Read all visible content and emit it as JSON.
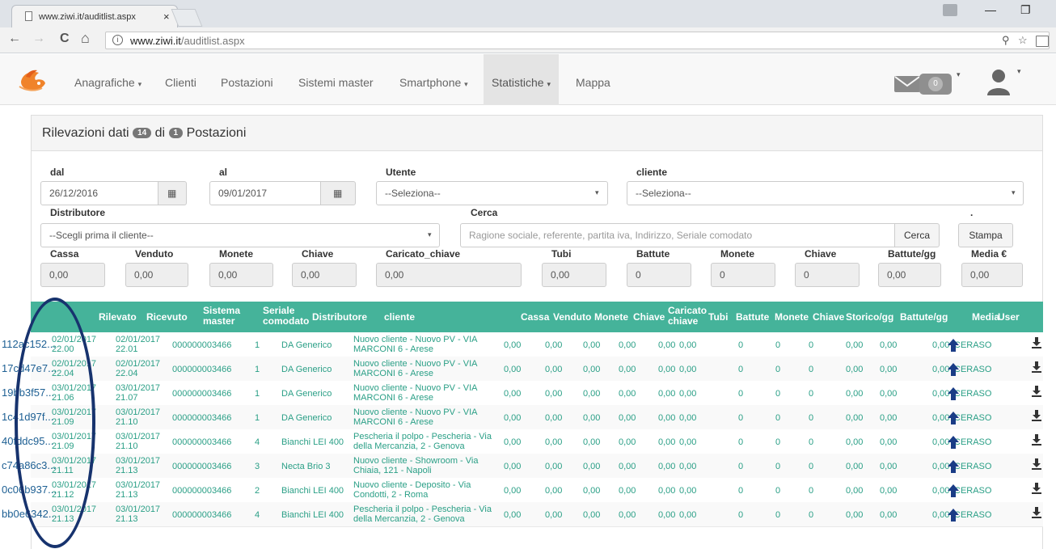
{
  "browser": {
    "tab_title": "www.ziwi.it/auditlist.aspx",
    "tab_close": "×",
    "url_host": "www.ziwi.it",
    "url_path": "/auditlist.aspx",
    "nav_back": "←",
    "nav_forward": "→",
    "nav_reload": "C",
    "nav_home": "⌂",
    "win_min": "—",
    "win_max": "❐",
    "zoom_icon": "⚲",
    "star_icon": "☆"
  },
  "appnav": {
    "items": [
      "Anagrafiche",
      "Clienti",
      "Postazioni",
      "Sistemi master",
      "Smartphone",
      "Statistiche",
      "Mappa"
    ],
    "active": "Statistiche",
    "dropdown_caret": "▾",
    "mail_count": "0",
    "colors": {
      "navbar_bg": "#f8f8f8",
      "accent": "#45b39a",
      "logo_orange": "#f0832a"
    }
  },
  "panel": {
    "title_prefix": "Rilevazioni dati",
    "count_rilevazioni": "14",
    "title_mid": "di",
    "count_postazioni": "1",
    "title_suffix": "Postazioni"
  },
  "filters": {
    "dal_label": "dal",
    "dal_value": "26/12/2016",
    "al_label": "al",
    "al_value": "09/01/2017",
    "utente_label": "Utente",
    "utente_value": "--Seleziona--",
    "cliente_label": "cliente",
    "cliente_value": "--Seleziona--",
    "distributore_label": "Distributore",
    "distributore_value": "--Scegli prima il cliente--",
    "cerca_label": "Cerca",
    "cerca_placeholder": "Ragione sociale, referente, partita iva, Indirizzo, Seriale comodato",
    "cerca_button": "Cerca",
    "stampa_label": ".",
    "stampa_button": "Stampa",
    "calendar_icon": "▦",
    "select_arrow": "▾"
  },
  "totals": {
    "labels": [
      "Cassa",
      "Venduto",
      "Monete",
      "Chiave",
      "Caricato_chiave",
      "Tubi",
      "Battute",
      "Monete",
      "Chiave",
      "Battute/gg",
      "Media €"
    ],
    "values": [
      "0,00",
      "0,00",
      "0,00",
      "0,00",
      "0,00",
      "0,00",
      "0",
      "0",
      "0",
      "0,00",
      "0,00"
    ]
  },
  "table": {
    "headers": [
      "Rilevato",
      "Ricevuto",
      "Sistema master",
      "Seriale comodato",
      "Distributore",
      "cliente",
      "Cassa",
      "Venduto",
      "Monete",
      "Chiave",
      "Caricato chiave",
      "Tubi",
      "Battute",
      "Monete",
      "Chiave",
      "Storico/gg",
      "Battute/gg",
      "Media",
      "User"
    ],
    "header_split": {
      "sistema_1": "Sistema",
      "sistema_2": "master",
      "seriale_1": "Seriale",
      "seriale_2": "comodato",
      "caricato_1": "Caricato",
      "caricato_2": "chiave"
    },
    "rows": [
      {
        "id": "112ac152...",
        "ril_d": "02/01/2017",
        "ril_t": "22.00",
        "ric_d": "02/01/2017",
        "ric_t": "22.01",
        "sistema": "000000003466",
        "seriale": "1",
        "distributore": "DA Generico",
        "cli_1": "Nuovo cliente - Nuovo PV - VIA",
        "cli_2": "MARCONI 6 - Arese",
        "cassa": "0,00",
        "venduto": "0,00",
        "monete": "0,00",
        "chiave": "0,00",
        "caricato": "0,00",
        "tubi": "0,00",
        "battute": "0",
        "monete2": "0",
        "chiave2": "0",
        "storico": "0,00",
        "battgg": "0,00",
        "media": "0,00",
        "user": "CERASO"
      },
      {
        "id": "17cd47e7...",
        "ril_d": "02/01/2017",
        "ril_t": "22.04",
        "ric_d": "02/01/2017",
        "ric_t": "22.04",
        "sistema": "000000003466",
        "seriale": "1",
        "distributore": "DA Generico",
        "cli_1": "Nuovo cliente - Nuovo PV - VIA",
        "cli_2": "MARCONI 6 - Arese",
        "cassa": "0,00",
        "venduto": "0,00",
        "monete": "0,00",
        "chiave": "0,00",
        "caricato": "0,00",
        "tubi": "0,00",
        "battute": "0",
        "monete2": "0",
        "chiave2": "0",
        "storico": "0,00",
        "battgg": "0,00",
        "media": "0,00",
        "user": "CERASO"
      },
      {
        "id": "19bb3f57...",
        "ril_d": "03/01/2017",
        "ril_t": "21.06",
        "ric_d": "03/01/2017",
        "ric_t": "21.07",
        "sistema": "000000003466",
        "seriale": "1",
        "distributore": "DA Generico",
        "cli_1": "Nuovo cliente - Nuovo PV - VIA",
        "cli_2": "MARCONI 6 - Arese",
        "cassa": "0,00",
        "venduto": "0,00",
        "monete": "0,00",
        "chiave": "0,00",
        "caricato": "0,00",
        "tubi": "0,00",
        "battute": "0",
        "monete2": "0",
        "chiave2": "0",
        "storico": "0,00",
        "battgg": "0,00",
        "media": "0,00",
        "user": "CERASO"
      },
      {
        "id": "1c41d97f...",
        "ril_d": "03/01/2017",
        "ril_t": "21.09",
        "ric_d": "03/01/2017",
        "ric_t": "21.10",
        "sistema": "000000003466",
        "seriale": "1",
        "distributore": "DA Generico",
        "cli_1": "Nuovo cliente - Nuovo PV - VIA",
        "cli_2": "MARCONI 6 - Arese",
        "cassa": "0,00",
        "venduto": "0,00",
        "monete": "0,00",
        "chiave": "0,00",
        "caricato": "0,00",
        "tubi": "0,00",
        "battute": "0",
        "monete2": "0",
        "chiave2": "0",
        "storico": "0,00",
        "battgg": "0,00",
        "media": "0,00",
        "user": "CERASO"
      },
      {
        "id": "40fddc95...",
        "ril_d": "03/01/2017",
        "ril_t": "21.09",
        "ric_d": "03/01/2017",
        "ric_t": "21.10",
        "sistema": "000000003466",
        "seriale": "4",
        "distributore": "Bianchi LEI 400",
        "cli_1": "Pescheria il polpo - Pescheria - Via",
        "cli_2": "della Mercanzia, 2 - Genova",
        "cassa": "0,00",
        "venduto": "0,00",
        "monete": "0,00",
        "chiave": "0,00",
        "caricato": "0,00",
        "tubi": "0,00",
        "battute": "0",
        "monete2": "0",
        "chiave2": "0",
        "storico": "0,00",
        "battgg": "0,00",
        "media": "0,00",
        "user": "CERASO"
      },
      {
        "id": "c74a86c3...",
        "ril_d": "03/01/2017",
        "ril_t": "21.11",
        "ric_d": "03/01/2017",
        "ric_t": "21.13",
        "sistema": "000000003466",
        "seriale": "3",
        "distributore": "Necta Brio 3",
        "cli_1": "Nuovo cliente - Showroom - Via",
        "cli_2": "Chiaia, 121 - Napoli",
        "cassa": "0,00",
        "venduto": "0,00",
        "monete": "0,00",
        "chiave": "0,00",
        "caricato": "0,00",
        "tubi": "0,00",
        "battute": "0",
        "monete2": "0",
        "chiave2": "0",
        "storico": "0,00",
        "battgg": "0,00",
        "media": "0,00",
        "user": "CERASO"
      },
      {
        "id": "0c06b937...",
        "ril_d": "03/01/2017",
        "ril_t": "21.12",
        "ric_d": "03/01/2017",
        "ric_t": "21.13",
        "sistema": "000000003466",
        "seriale": "2",
        "distributore": "Bianchi LEI 400",
        "cli_1": "Nuovo cliente - Deposito - Via",
        "cli_2": "Condotti, 2 - Roma",
        "cassa": "0,00",
        "venduto": "0,00",
        "monete": "0,00",
        "chiave": "0,00",
        "caricato": "0,00",
        "tubi": "0,00",
        "battute": "0",
        "monete2": "0",
        "chiave2": "0",
        "storico": "0,00",
        "battgg": "0,00",
        "media": "0,00",
        "user": "CERASO"
      },
      {
        "id": "bb0e6342...",
        "ril_d": "03/01/2017",
        "ril_t": "21.13",
        "ric_d": "03/01/2017",
        "ric_t": "21.13",
        "sistema": "000000003466",
        "seriale": "4",
        "distributore": "Bianchi LEI 400",
        "cli_1": "Pescheria il polpo - Pescheria - Via",
        "cli_2": "della Mercanzia, 2 - Genova",
        "cassa": "0,00",
        "venduto": "0,00",
        "monete": "0,00",
        "chiave": "0,00",
        "caricato": "0,00",
        "tubi": "0,00",
        "battute": "0",
        "monete2": "0",
        "chiave2": "0",
        "storico": "0,00",
        "battgg": "0,00",
        "media": "0,00",
        "user": "CERASO"
      }
    ]
  }
}
